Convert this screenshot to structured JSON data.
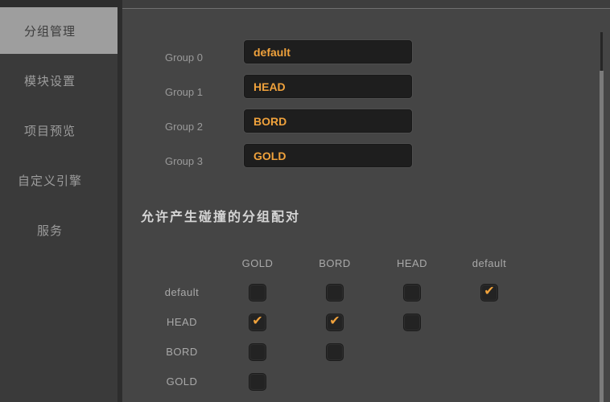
{
  "colors": {
    "accent_orange": "#f0a23c",
    "content_bg": "#454545",
    "sidebar_bg": "#3a3a3a",
    "selected_item_bg": "#9e9e9e",
    "field_bg": "#1e1e1e",
    "base_bg": "#2d2d2d"
  },
  "sidebar": {
    "items": [
      {
        "id": "group-manager",
        "label": "分组管理",
        "selected": true
      },
      {
        "id": "module-settings",
        "label": "模块设置",
        "selected": false
      },
      {
        "id": "project-preview",
        "label": "项目预览",
        "selected": false
      },
      {
        "id": "custom-engine",
        "label": "自定义引擎",
        "selected": false
      },
      {
        "id": "services",
        "label": "服务",
        "selected": false
      }
    ]
  },
  "groups": {
    "rows": [
      {
        "label": "Group 0",
        "value": "default"
      },
      {
        "label": "Group 1",
        "value": "HEAD"
      },
      {
        "label": "Group 2",
        "value": "BORD"
      },
      {
        "label": "Group 3",
        "value": "GOLD"
      }
    ]
  },
  "collision": {
    "title": "允许产生碰撞的分组配对",
    "check_glyph": "✔",
    "columns": [
      "GOLD",
      "BORD",
      "HEAD",
      "default"
    ],
    "rows": [
      {
        "label": "default",
        "cells": [
          false,
          false,
          false,
          true
        ]
      },
      {
        "label": "HEAD",
        "cells": [
          true,
          true,
          false,
          null
        ]
      },
      {
        "label": "BORD",
        "cells": [
          false,
          false,
          null,
          null
        ]
      },
      {
        "label": "GOLD",
        "cells": [
          false,
          null,
          null,
          null
        ]
      }
    ]
  }
}
